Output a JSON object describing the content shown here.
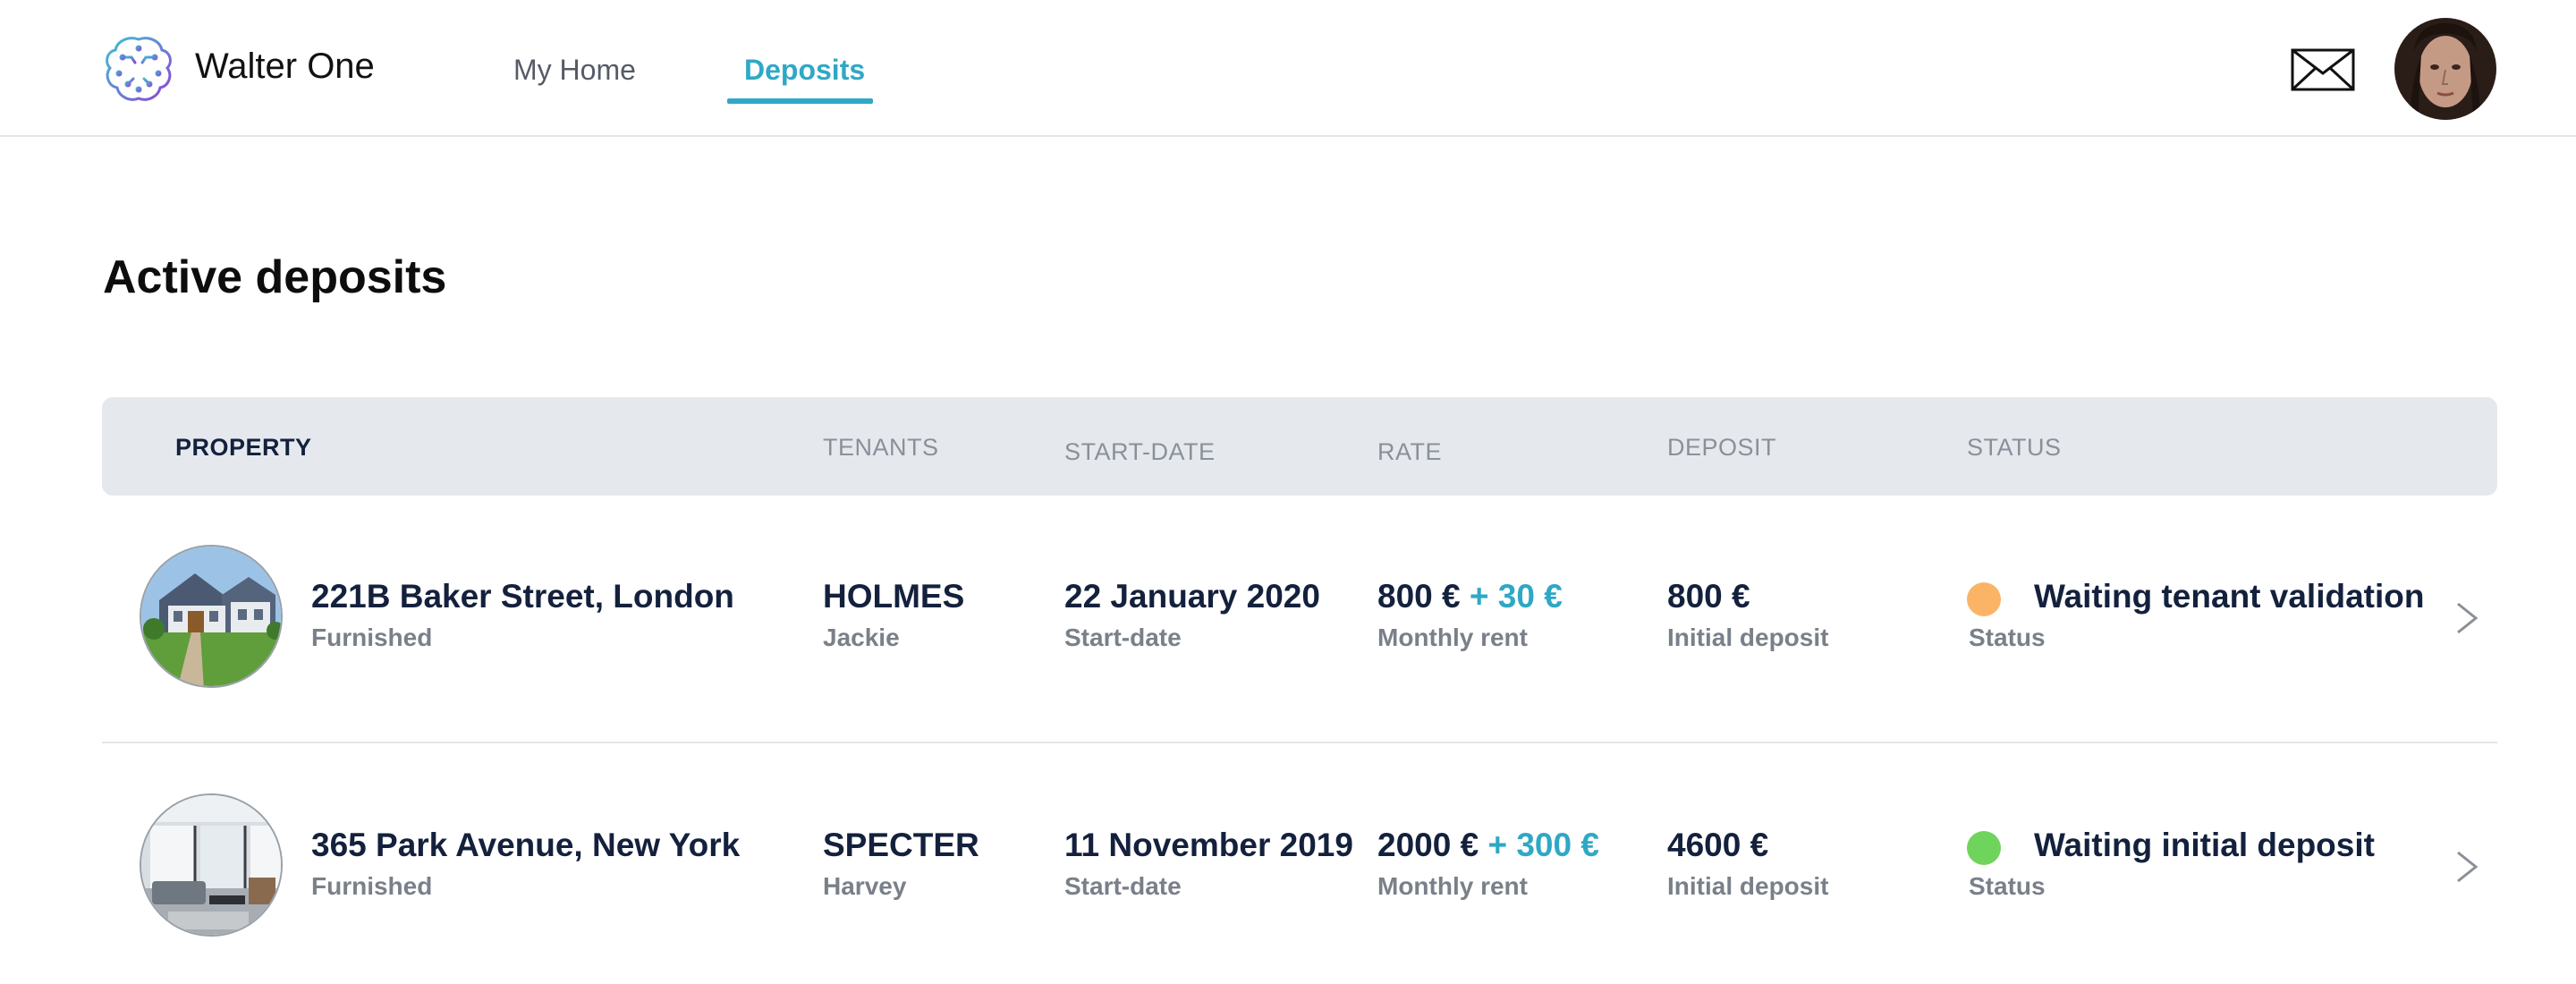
{
  "header": {
    "brand": "Walter One",
    "nav": [
      {
        "label": "My Home"
      },
      {
        "label": "Deposits"
      }
    ]
  },
  "page": {
    "title": "Active deposits"
  },
  "table": {
    "columns": [
      "PROPERTY",
      "TENANTS",
      "START-DATE",
      "RATE",
      "DEPOSIT",
      "STATUS"
    ],
    "rows": [
      {
        "address": "221B Baker Street, London",
        "type": "Furnished",
        "tenant_last": "HOLMES",
        "tenant_first": "Jackie",
        "start_date": "22 January 2020",
        "start_label": "Start-date",
        "rent": "800 €",
        "rent_extra": "+ 30 €",
        "rent_label": "Monthly rent",
        "deposit": "800 €",
        "deposit_label": "Initial deposit",
        "status": "Waiting tenant validation",
        "status_label": "Status",
        "status_color": "#fbb466"
      },
      {
        "address": "365 Park Avenue, New York",
        "type": "Furnished",
        "tenant_last": "SPECTER",
        "tenant_first": "Harvey",
        "start_date": "11 November 2019",
        "start_label": "Start-date",
        "rent": "2000 €",
        "rent_extra": "+ 300 €",
        "rent_label": "Monthly rent",
        "deposit": "4600 €",
        "deposit_label": "Initial deposit",
        "status": "Waiting initial deposit",
        "status_label": "Status",
        "status_color": "#6fd45c"
      }
    ]
  },
  "colors": {
    "accent": "#2fa8c6",
    "text_primary": "#14213d",
    "text_secondary": "#7a8089",
    "table_header_bg": "#e5e9ee"
  },
  "icons": [
    "brain-logo-icon",
    "mail-icon",
    "chevron-right-icon"
  ]
}
